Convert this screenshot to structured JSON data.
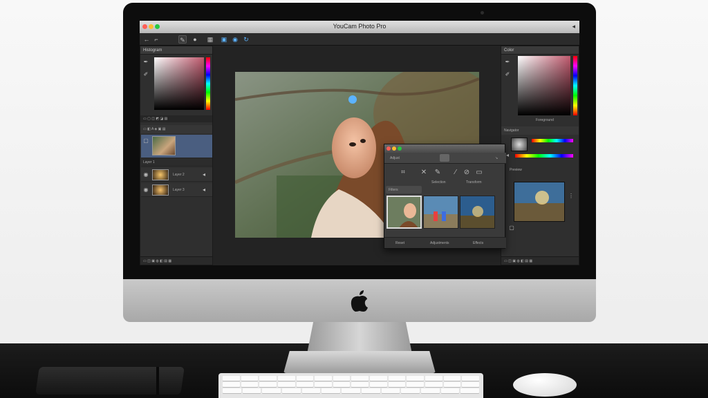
{
  "window": {
    "title": "YouCam Photo Pro"
  },
  "toolbar": {
    "tools": [
      "back-arrow-icon",
      "crop-tool-icon",
      "brush-tool-icon",
      "dodge-tool-icon",
      "grid-tool-icon",
      "frame-tool-icon",
      "eye-tool-icon"
    ]
  },
  "left_panel": {
    "header": "Histogram",
    "layers": [
      {
        "label": "Layer 1"
      },
      {
        "label": "Layer 2"
      },
      {
        "label": "Layer 3"
      }
    ]
  },
  "right_panel": {
    "header": "Color",
    "swatch_label": "Foreground",
    "section2_header": "Navigator",
    "preview_label": "Preview"
  },
  "dialog": {
    "tab1": "Adjust",
    "tab2": "Filters",
    "tools": [
      "crop-icon",
      "scissors-icon",
      "brush-icon",
      "magic-wand-icon",
      "layers-icon"
    ],
    "tool_label_1": "Selection",
    "tool_label_2": "Transform",
    "section": "Filters",
    "footer": [
      "Reset",
      "Adjustments",
      "Effects"
    ]
  },
  "colors": {
    "accent": "#5cb3ff",
    "selected_layer": "#4a5e80",
    "panel_bg": "#2f2f2f"
  }
}
